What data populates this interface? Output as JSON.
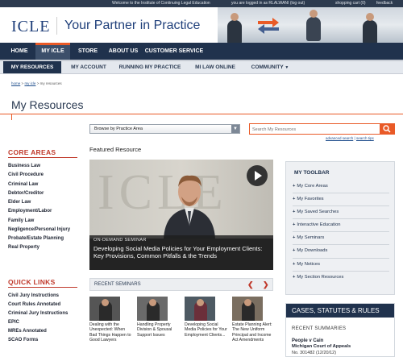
{
  "topbar": {
    "welcome": "Welcome to the Institute of Continuing Legal Education",
    "logged_in": "you are logged in as RLALWANI (log out)",
    "cart": "shopping cart (0)",
    "feedback": "feedback"
  },
  "brand": {
    "logo": "ICLE",
    "tagline": "Your Partner in Practice"
  },
  "nav1": [
    "HOME",
    "MY ICLE",
    "STORE",
    "ABOUT US",
    "CUSTOMER SERVICE"
  ],
  "nav2": [
    "MY RESOURCES",
    "MY ACCOUNT",
    "RUNNING MY PRACTICE",
    "MI LAW ONLINE",
    "COMMUNITY"
  ],
  "breadcrumb": {
    "home": "home",
    "sep": ">",
    "myicle": "my icle",
    "current": "my resources"
  },
  "page_title": "My Resources",
  "browse": {
    "label": "Browse by Practice Area"
  },
  "search": {
    "placeholder": "Search My Resources",
    "advanced": "advanced search",
    "sep": "|",
    "tips": "search tips"
  },
  "sidebar": {
    "core_title": "CORE AREAS",
    "core": [
      "Business Law",
      "Civil Procedure",
      "Criminal Law",
      "Debtor/Creditor",
      "Elder Law",
      "Employment/Labor",
      "Family Law",
      "Negligence/Personal Injury",
      "Probate/Estate Planning",
      "Real Property"
    ],
    "quick_title": "QUICK LINKS",
    "quick": [
      "Civil Jury Instructions",
      "Court Rules Annotated",
      "Criminal Jury Instructions",
      "EPIC",
      "MREs Annotated",
      "SCAO Forms"
    ]
  },
  "featured": {
    "label": "Featured Resource",
    "kind": "ON-DEMAND SEMINAR",
    "title": "Developing Social Media Policies for Your Employment Clients: Key Provisions, Common Pitfalls & the Trends",
    "watermark": "ICLE"
  },
  "recent": {
    "label": "RECENT SEMINARS",
    "items": [
      "Dealing with the Unexpected: When Bad Things Happen to Good Lawyers",
      "Handling Property Division & Spousal Support Issues",
      "Developing Social Media Policies for Your Employment Clients...",
      "Estate Planning Alert: The New Uniform Principal and Income Act Amendments"
    ]
  },
  "toolbar": {
    "title": "MY TOOLBAR",
    "items": [
      "My Core Areas",
      "My Favorites",
      "My Saved Searches",
      "Interactive Education",
      "My Seminars",
      "My Downloads",
      "My Notices",
      "My Section Resources"
    ]
  },
  "cases": {
    "title": "CASES, STATUTES & RULES",
    "sub": "RECENT SUMMARIES",
    "case_name": "People v Cain",
    "court": "Michigan Court of Appeals",
    "docket": "No. 301482 (12/20/12)"
  },
  "colors": {
    "navy": "#20324d",
    "accent": "#e95a27",
    "red": "#c0392b"
  }
}
